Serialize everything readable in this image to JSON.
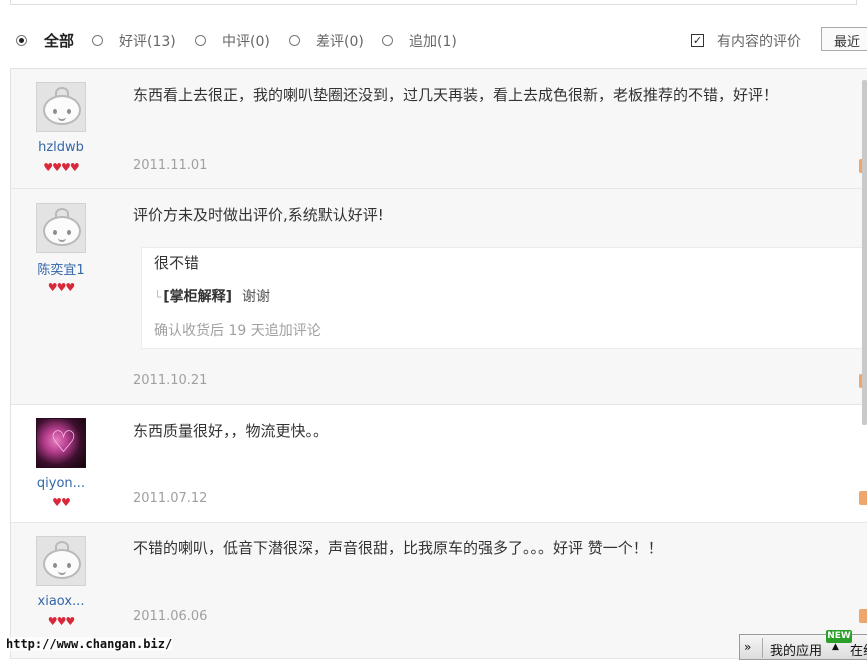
{
  "filters": {
    "options": [
      {
        "label": "全部",
        "selected": true
      },
      {
        "label": "好评(13)",
        "selected": false
      },
      {
        "label": "中评(0)",
        "selected": false
      },
      {
        "label": "差评(0)",
        "selected": false
      },
      {
        "label": "追加(1)",
        "selected": false
      }
    ],
    "content_only_label": "有内容的评价",
    "content_only_checked": true,
    "sort_label": "最近"
  },
  "reviews": [
    {
      "user": "hzldwb",
      "rank_glyphs": "♥♥♥♥",
      "text": "东西看上去很正，我的喇叭垫圈还没到，过几天再装，看上去成色很新，老板推荐的不错，好评！",
      "date": "2011.11.01"
    },
    {
      "user": "陈奕宜1",
      "rank_glyphs": "♥♥♥",
      "text": "评价方未及时做出评价,系统默认好评!",
      "append": {
        "text": "很不错",
        "seller_label": "[掌柜解释]",
        "seller_reply": "谢谢",
        "note": "确认收货后  19 天追加评论"
      },
      "date": "2011.10.21"
    },
    {
      "user": "qiyon...",
      "rank_glyphs": "♥♥",
      "text": "东西质量很好，，物流更快。。",
      "date": "2011.07.12"
    },
    {
      "user": "xiaox...",
      "rank_glyphs": "♥♥♥",
      "text": "不错的喇叭，低音下潜很深，声音很甜，比我原车的强多了。。。好评 赞一个！！",
      "date": "2011.06.06"
    }
  ],
  "overlay": {
    "watermark": "http://www.changan.biz/",
    "app_bar_chevron": "»",
    "app_bar_label": "我的应用",
    "app_bar_arrow": "▲",
    "app_bar_more": "在线",
    "new_badge": "NEW"
  },
  "colors": {
    "username": "#3366aa",
    "date": "#a0a0a0",
    "rank": "#d8283a",
    "shaded_row": "#f7f7f7"
  }
}
